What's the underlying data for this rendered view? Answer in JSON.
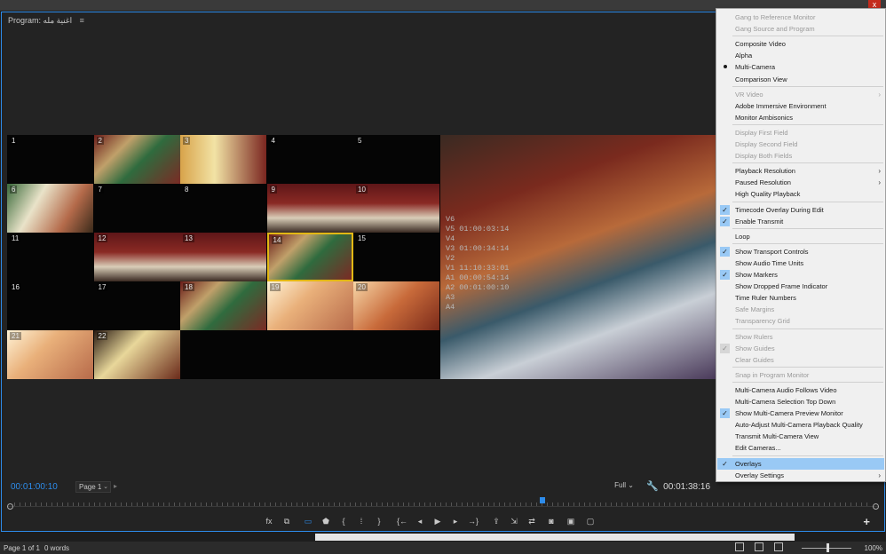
{
  "window": {
    "close_label": "x"
  },
  "monitor": {
    "title": "Program: اغنية مله",
    "menu_glyph": "≡"
  },
  "cells": [
    {
      "n": "1",
      "img": ""
    },
    {
      "n": "2",
      "img": "img-a"
    },
    {
      "n": "3",
      "img": "img-b"
    },
    {
      "n": "4",
      "img": ""
    },
    {
      "n": "5",
      "img": ""
    },
    {
      "n": "6",
      "img": "img-c"
    },
    {
      "n": "7",
      "img": ""
    },
    {
      "n": "8",
      "img": ""
    },
    {
      "n": "9",
      "img": "img-d"
    },
    {
      "n": "10",
      "img": "img-d"
    },
    {
      "n": "11",
      "img": ""
    },
    {
      "n": "12",
      "img": "img-d"
    },
    {
      "n": "13",
      "img": "img-d"
    },
    {
      "n": "14",
      "img": "img-a"
    },
    {
      "n": "15",
      "img": ""
    },
    {
      "n": "16",
      "img": ""
    },
    {
      "n": "17",
      "img": ""
    },
    {
      "n": "18",
      "img": "img-a"
    },
    {
      "n": "19",
      "img": "img-e"
    },
    {
      "n": "20",
      "img": "img-f"
    },
    {
      "n": "21",
      "img": "img-e"
    },
    {
      "n": "22",
      "img": "img-g"
    }
  ],
  "selected_cell": "14",
  "timecode_overlay": [
    "V6",
    "V5 01:00:03:14",
    "V4",
    "V3 01:00:34:14",
    "V2",
    "V1 11:10:33:01",
    "A1 00:00:54:14",
    "A2 00:01:00:10",
    "A3",
    "A4"
  ],
  "controls": {
    "timecode_left": "00:01:00:10",
    "page_select": "Page 1",
    "resolution": "Full",
    "timecode_right": "00:01:38:16"
  },
  "transport_buttons": [
    {
      "name": "fx-icon",
      "glyph": "fx"
    },
    {
      "name": "toggle-proxies-icon",
      "glyph": "⧉"
    },
    {
      "name": "multicam-icon",
      "glyph": "▭"
    },
    {
      "name": "add-marker-icon",
      "glyph": "⬟"
    },
    {
      "name": "mark-in-icon",
      "glyph": "{"
    },
    {
      "name": "clear-in-out-icon",
      "glyph": "⁞"
    },
    {
      "name": "mark-out-icon",
      "glyph": "}"
    },
    {
      "name": "go-to-in-icon",
      "glyph": "{←"
    },
    {
      "name": "step-back-icon",
      "glyph": "◂"
    },
    {
      "name": "play-icon",
      "glyph": "▶"
    },
    {
      "name": "step-forward-icon",
      "glyph": "▸"
    },
    {
      "name": "go-to-out-icon",
      "glyph": "→}"
    },
    {
      "name": "lift-icon",
      "glyph": "⇪"
    },
    {
      "name": "extract-icon",
      "glyph": "⇲"
    },
    {
      "name": "insert-icon",
      "glyph": "⇄"
    },
    {
      "name": "export-frame-icon",
      "glyph": "◙"
    },
    {
      "name": "comparison-view-icon",
      "glyph": "▣"
    },
    {
      "name": "vr-icon",
      "glyph": "▢"
    }
  ],
  "status_bar": {
    "page": "Page 1 of 1",
    "words": "0 words",
    "zoom": "100%"
  },
  "context_menu": {
    "items": [
      {
        "label": "Gang to Reference Monitor",
        "disabled": true
      },
      {
        "label": "Gang Source and Program",
        "disabled": true
      },
      {
        "sep": true
      },
      {
        "label": "Composite Video"
      },
      {
        "label": "Alpha"
      },
      {
        "label": "Multi-Camera",
        "bullet": true
      },
      {
        "label": "Comparison View"
      },
      {
        "sep": true
      },
      {
        "label": "VR Video",
        "disabled": true,
        "submenu": true
      },
      {
        "label": "Adobe Immersive Environment"
      },
      {
        "label": "Monitor Ambisonics"
      },
      {
        "sep": true
      },
      {
        "label": "Display First Field",
        "disabled": true
      },
      {
        "label": "Display Second Field",
        "disabled": true
      },
      {
        "label": "Display Both Fields",
        "disabled": true
      },
      {
        "sep": true
      },
      {
        "label": "Playback Resolution",
        "submenu": true
      },
      {
        "label": "Paused Resolution",
        "submenu": true
      },
      {
        "label": "High Quality Playback"
      },
      {
        "sep": true
      },
      {
        "label": "Timecode Overlay During Edit",
        "checked": true
      },
      {
        "label": "Enable Transmit",
        "checked": true
      },
      {
        "sep": true
      },
      {
        "label": "Loop"
      },
      {
        "sep": true
      },
      {
        "label": "Show Transport Controls",
        "checked": true
      },
      {
        "label": "Show Audio Time Units"
      },
      {
        "label": "Show Markers",
        "checked": true
      },
      {
        "label": "Show Dropped Frame Indicator"
      },
      {
        "label": "Time Ruler Numbers"
      },
      {
        "label": "Safe Margins",
        "disabled": true
      },
      {
        "label": "Transparency Grid",
        "disabled": true
      },
      {
        "sep": true
      },
      {
        "label": "Show Rulers",
        "disabled": true
      },
      {
        "label": "Show Guides",
        "disabled": true,
        "checked": true
      },
      {
        "label": "Clear Guides",
        "disabled": true
      },
      {
        "sep": true
      },
      {
        "label": "Snap in Program Monitor",
        "disabled": true
      },
      {
        "sep": true
      },
      {
        "label": "Multi-Camera Audio Follows Video"
      },
      {
        "label": "Multi-Camera Selection Top Down"
      },
      {
        "label": "Show Multi-Camera Preview Monitor",
        "checked": true
      },
      {
        "label": "Auto-Adjust Multi-Camera Playback Quality"
      },
      {
        "label": "Transmit Multi-Camera View"
      },
      {
        "label": "Edit Cameras..."
      },
      {
        "sep": true
      },
      {
        "label": "Overlays",
        "checked": true,
        "highlighted": true
      },
      {
        "label": "Overlay Settings",
        "submenu": true
      }
    ]
  },
  "colors": {
    "accent": "#2d8ceb",
    "selected_cell_border": "#e3b814",
    "menu_highlight": "#99c9f5"
  }
}
